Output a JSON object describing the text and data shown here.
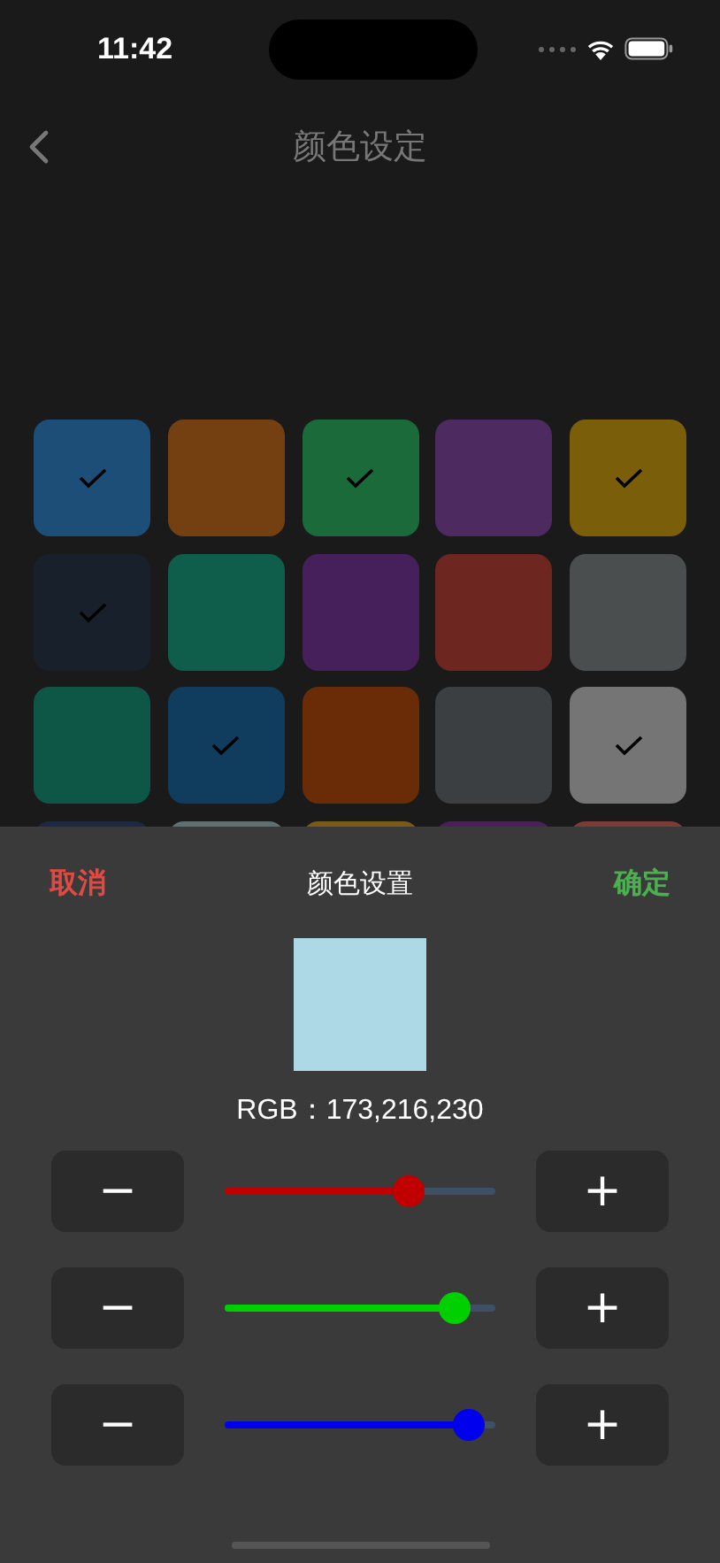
{
  "status_bar": {
    "time": "11:42"
  },
  "nav": {
    "title": "颜色设定"
  },
  "tiles": [
    {
      "color": "#1c4e78",
      "selected": true
    },
    {
      "color": "#744012",
      "selected": false
    },
    {
      "color": "#1b6a3a",
      "selected": true
    },
    {
      "color": "#4d2a60",
      "selected": false
    },
    {
      "color": "#7a5e0a",
      "selected": true
    },
    {
      "color": "#18202b",
      "selected": true
    },
    {
      "color": "#0f5e4c",
      "selected": false
    },
    {
      "color": "#46205a",
      "selected": false
    },
    {
      "color": "#6e2620",
      "selected": false
    },
    {
      "color": "#4a4e4e",
      "selected": false
    },
    {
      "color": "#0e5646",
      "selected": false
    },
    {
      "color": "#103d5e",
      "selected": true
    },
    {
      "color": "#6a2c06",
      "selected": false
    },
    {
      "color": "#3c3f42",
      "selected": false
    },
    {
      "color": "#757575",
      "selected": true
    },
    {
      "color": "#1b2a40"
    },
    {
      "color": "#5e7070"
    },
    {
      "color": "#7a5a18"
    },
    {
      "color": "#4a2058"
    },
    {
      "color": "#7a3c34"
    }
  ],
  "sheet": {
    "cancel": "取消",
    "title": "颜色设置",
    "confirm": "确定",
    "preview": {
      "color": "#add8e6"
    },
    "rgb_label": "RGB：173,216,230",
    "sliders": [
      {
        "color": "#c00000",
        "level": 0.68,
        "minus": "−",
        "plus": "+"
      },
      {
        "color": "#00d000",
        "level": 0.85,
        "minus": "−",
        "plus": "+"
      },
      {
        "color": "#0000ee",
        "level": 0.9,
        "minus": "−",
        "plus": "+"
      }
    ]
  }
}
